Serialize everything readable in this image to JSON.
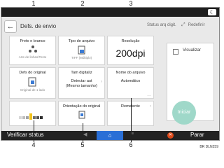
{
  "callouts": [
    "1",
    "2",
    "3",
    "4",
    "5",
    "6"
  ],
  "header": {
    "title": "Defs. de envio",
    "status_link": "Status arq digit.",
    "reset": "Redefinir",
    "back_icon": "back-arrow-icon"
  },
  "tiles": {
    "mode": {
      "label": "Preto e branco",
      "sub": "Arte de linhas/Texto"
    },
    "filetype": {
      "label": "Tipo de arquivo",
      "sub": "TIFF (Múltiplo)"
    },
    "resolution": {
      "label": "Resolução",
      "value": "200dpi"
    },
    "original_settings": {
      "label": "Defs do original",
      "sub": "Original de 1 lado"
    },
    "scan_size": {
      "label": "Tam digitaliz",
      "value_line1": "Detectar aut",
      "value_line2": "(Mesmo tamanho)"
    },
    "file_name": {
      "label": "Nome do arquivo",
      "value": "Automático"
    },
    "orientation": {
      "label": "Orientação do original"
    },
    "sender": {
      "label": "Remetente"
    }
  },
  "right_panel": {
    "checkbox_label": "Visualizar",
    "checked": false
  },
  "start_button": "Iniciar",
  "bottom": {
    "verificar": "Verificar status",
    "parar": "Parar"
  },
  "figure_code": "BR DLN259",
  "colors": {
    "start": "#9fd8c9",
    "home": "#2a6fd6",
    "stop": "#e04a1a"
  }
}
